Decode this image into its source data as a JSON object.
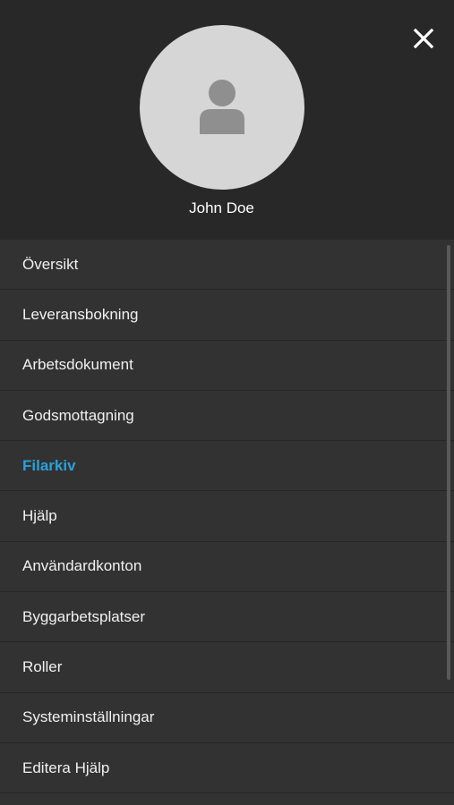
{
  "profile": {
    "avatar_icon": "person-icon",
    "name": "John Doe"
  },
  "close_icon": "close-icon",
  "menu": {
    "items": [
      {
        "label": "Översikt"
      },
      {
        "label": "Leveransbokning"
      },
      {
        "label": "Arbetsdokument"
      },
      {
        "label": "Godsmottagning"
      },
      {
        "label": "Filarkiv",
        "active": true
      },
      {
        "label": "Hjälp"
      },
      {
        "label": "Användardkonton"
      },
      {
        "label": "Byggarbetsplatser"
      },
      {
        "label": "Roller"
      },
      {
        "label": "Systeminställningar"
      },
      {
        "label": "Editera Hjälp"
      }
    ]
  },
  "colors": {
    "header_bg": "#292828",
    "menu_bg": "#323232",
    "active_text": "#28a1dc",
    "text": "#f1f1f1",
    "avatar_bg": "#d6d6d6",
    "avatar_icon": "#8f8f8f"
  }
}
